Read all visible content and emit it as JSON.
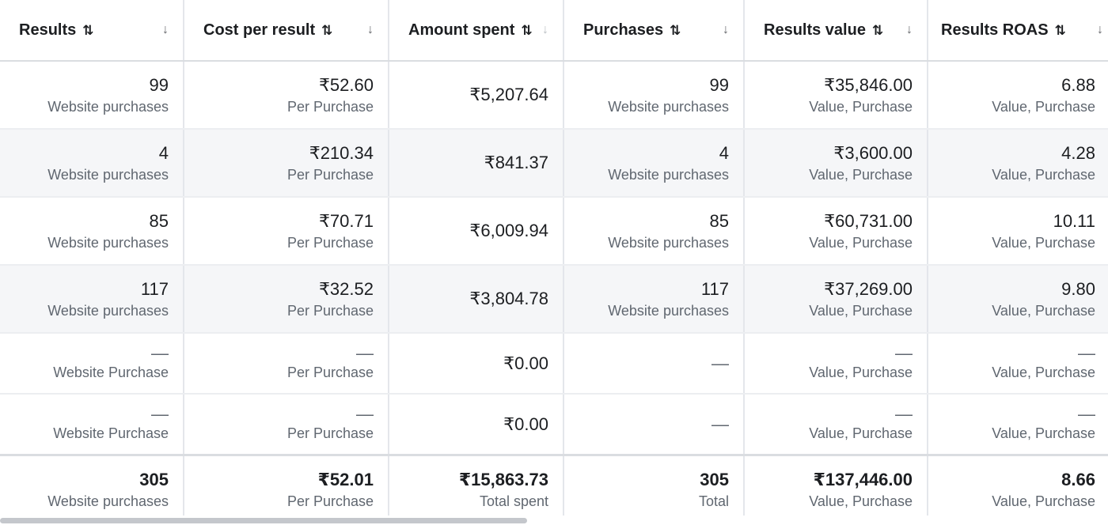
{
  "headers": [
    {
      "label": "Results",
      "sort": "⇅",
      "chev": "↓"
    },
    {
      "label": "Cost per result",
      "sort": "⇅",
      "chev": "↓"
    },
    {
      "label": "Amount spent",
      "sort": "⇅",
      "chev": "↓"
    },
    {
      "label": "Purchases",
      "sort": "⇅",
      "chev": "↓"
    },
    {
      "label": "Results value",
      "sort": "⇅",
      "chev": "↓"
    },
    {
      "label": "Results ROAS",
      "sort": "⇅",
      "chev": "↓"
    }
  ],
  "rows": [
    {
      "results": "99",
      "results_sub": "Website purchases",
      "cost": "₹52.60",
      "cost_sub": "Per Purchase",
      "spent": "₹5,207.64",
      "purchases": "99",
      "purchases_sub": "Website purchases",
      "value": "₹35,846.00",
      "value_sub": "Value, Purchase",
      "roas": "6.88",
      "roas_sub": "Value, Purchase"
    },
    {
      "results": "4",
      "results_sub": "Website purchases",
      "cost": "₹210.34",
      "cost_sub": "Per Purchase",
      "spent": "₹841.37",
      "purchases": "4",
      "purchases_sub": "Website purchases",
      "value": "₹3,600.00",
      "value_sub": "Value, Purchase",
      "roas": "4.28",
      "roas_sub": "Value, Purchase"
    },
    {
      "results": "85",
      "results_sub": "Website purchases",
      "cost": "₹70.71",
      "cost_sub": "Per Purchase",
      "spent": "₹6,009.94",
      "purchases": "85",
      "purchases_sub": "Website purchases",
      "value": "₹60,731.00",
      "value_sub": "Value, Purchase",
      "roas": "10.11",
      "roas_sub": "Value, Purchase"
    },
    {
      "results": "117",
      "results_sub": "Website purchases",
      "cost": "₹32.52",
      "cost_sub": "Per Purchase",
      "spent": "₹3,804.78",
      "purchases": "117",
      "purchases_sub": "Website purchases",
      "value": "₹37,269.00",
      "value_sub": "Value, Purchase",
      "roas": "9.80",
      "roas_sub": "Value, Purchase"
    },
    {
      "results": "—",
      "results_sub": "Website Purchase",
      "cost": "—",
      "cost_sub": "Per Purchase",
      "spent": "₹0.00",
      "purchases": "—",
      "value": "—",
      "value_sub": "Value, Purchase",
      "roas": "—",
      "roas_sub": "Value, Purchase"
    },
    {
      "results": "—",
      "results_sub": "Website Purchase",
      "cost": "—",
      "cost_sub": "Per Purchase",
      "spent": "₹0.00",
      "purchases": "—",
      "value": "—",
      "value_sub": "Value, Purchase",
      "roas": "—",
      "roas_sub": "Value, Purchase"
    }
  ],
  "totals": {
    "results": "305",
    "results_sub": "Website purchases",
    "cost": "₹52.01",
    "cost_sub": "Per Purchase",
    "spent": "₹15,863.73",
    "spent_sub": "Total spent",
    "purchases": "305",
    "purchases_sub": "Total",
    "value": "₹137,446.00",
    "value_sub": "Value, Purchase",
    "roas": "8.66",
    "roas_sub": "Value, Purchase"
  }
}
